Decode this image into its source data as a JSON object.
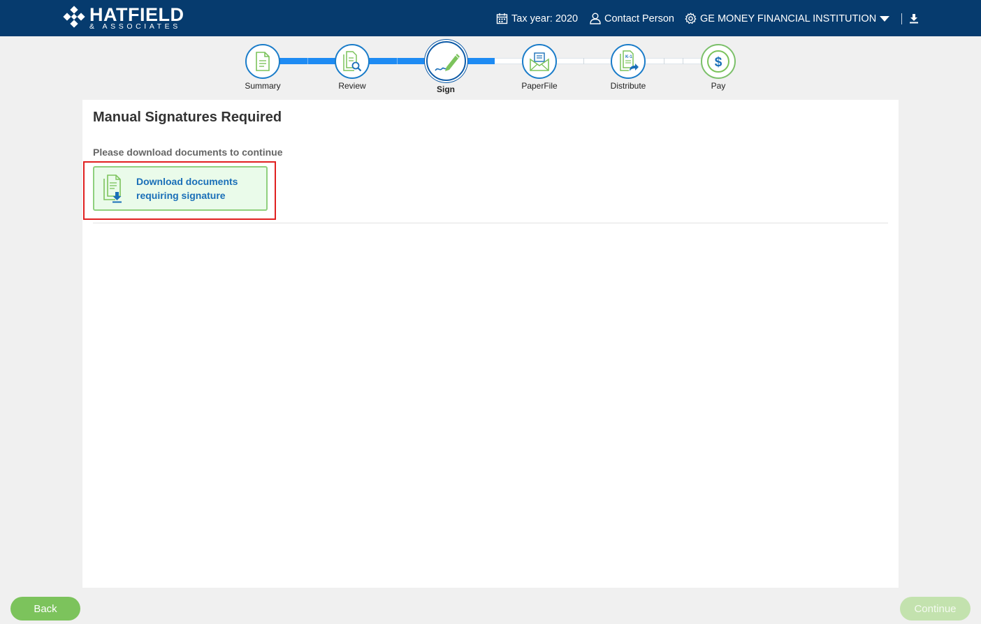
{
  "header": {
    "logo_name": "HATFIELD",
    "logo_sub": "& ASSOCIATES",
    "tax_year": "Tax year: 2020",
    "contact": "Contact Person",
    "institution": "GE MONEY FINANCIAL INSTITUTION"
  },
  "stepper": {
    "steps": [
      {
        "label": "Summary",
        "icon": "document-icon",
        "state": "done"
      },
      {
        "label": "Review",
        "icon": "document-search-icon",
        "state": "done"
      },
      {
        "label": "Sign",
        "icon": "pen-signature-icon",
        "state": "active"
      },
      {
        "label": "PaperFile",
        "icon": "envelope-icon",
        "state": "todo"
      },
      {
        "label": "Distribute",
        "icon": "k1-share-icon",
        "state": "todo"
      },
      {
        "label": "Pay",
        "icon": "dollar-icon",
        "state": "todo"
      }
    ]
  },
  "main": {
    "title": "Manual Signatures Required",
    "subtitle": "Please download documents to continue",
    "download_button_line1": "Download documents",
    "download_button_line2": "requiring signature"
  },
  "footer": {
    "back_label": "Back",
    "continue_label": "Continue"
  },
  "colors": {
    "header_bg": "#063b6e",
    "accent_blue": "#1e8bf3",
    "accent_green": "#7cc35c",
    "highlight_red": "#e02020"
  }
}
